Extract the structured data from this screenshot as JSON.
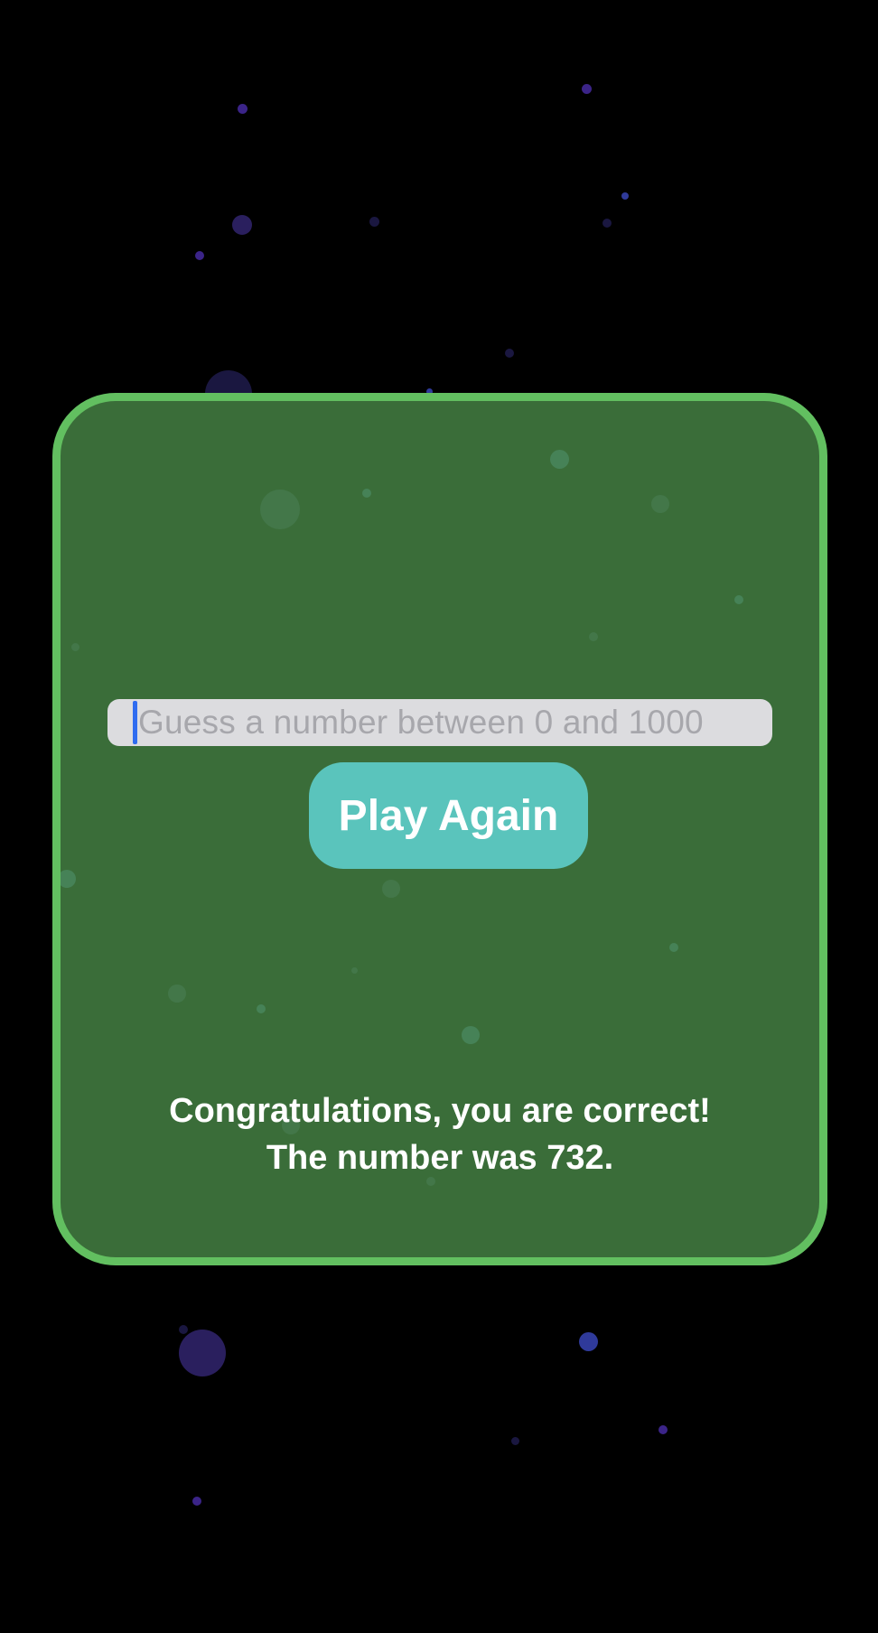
{
  "game": {
    "input": {
      "value": "",
      "placeholder": "Guess a number between 0 and 1000"
    },
    "play_again_label": "Play Again",
    "result": {
      "line1": "Congratulations, you are correct!",
      "line2": "The number was 732."
    }
  },
  "colors": {
    "background": "#000000",
    "card_fill": "#3a6d39",
    "card_border": "#62bf60",
    "button": "#5ac4bc",
    "input_fill": "#dcdcdf",
    "caret": "#2f6cf0"
  }
}
